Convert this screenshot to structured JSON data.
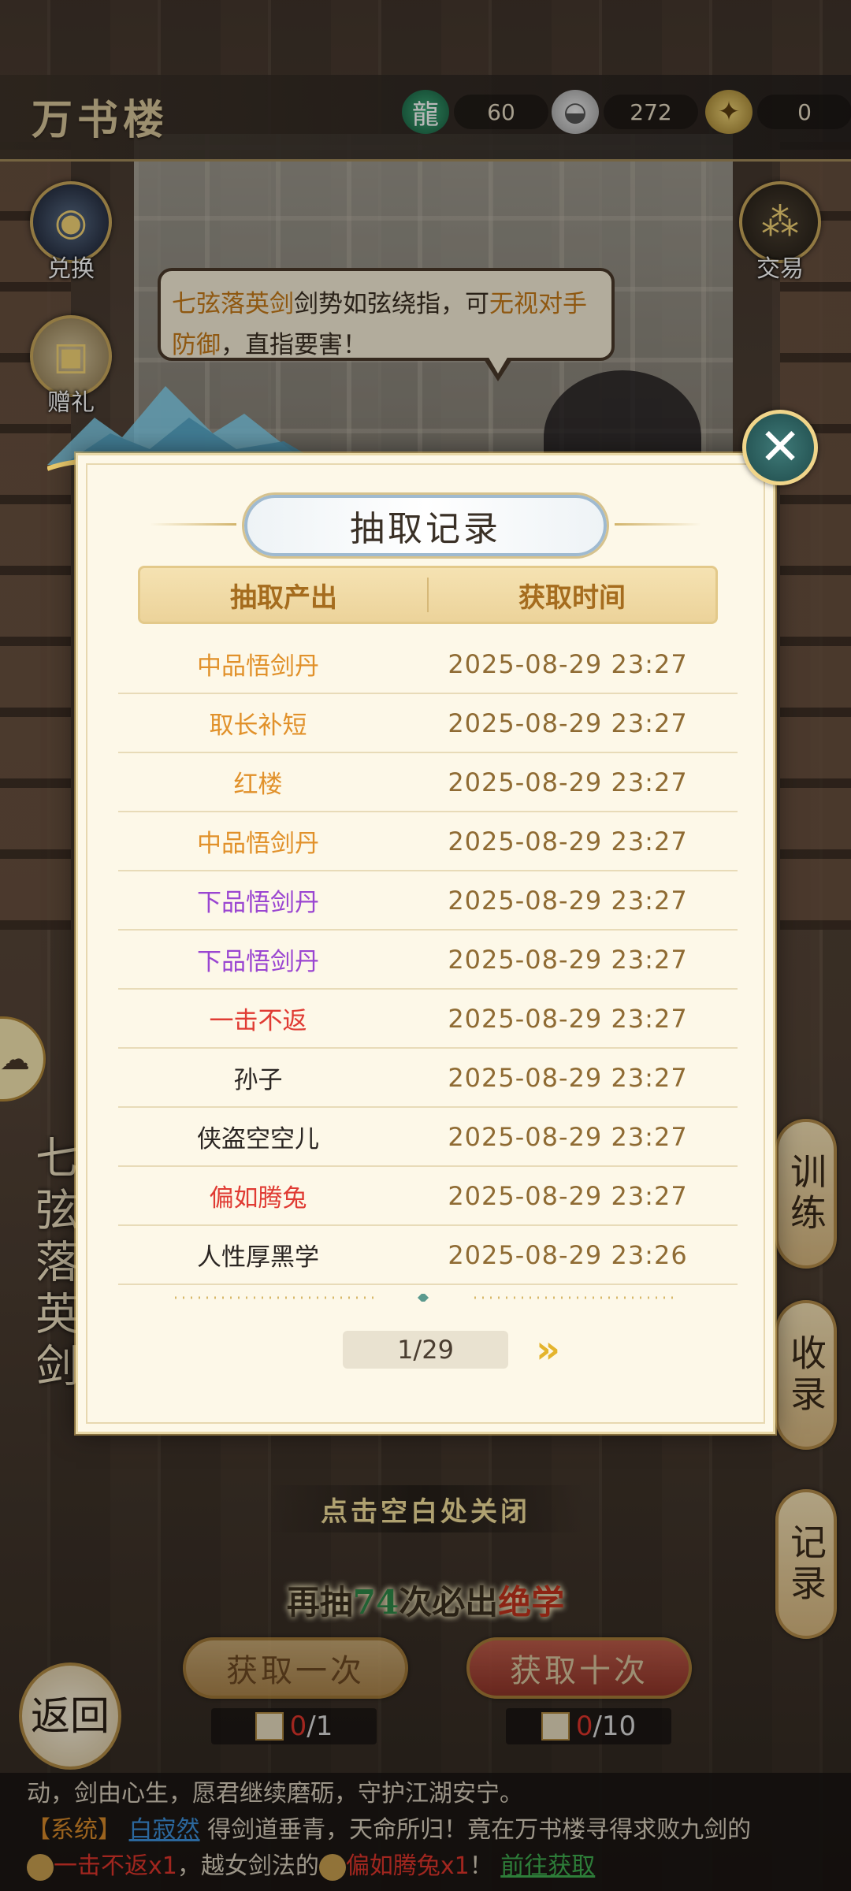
{
  "header": {
    "title": "万书楼",
    "currencies": [
      {
        "icon": "jade-dragon-icon",
        "value": "60"
      },
      {
        "icon": "silver-ingot-icon",
        "value": "272"
      },
      {
        "icon": "ticket-scroll-icon",
        "value": "0"
      }
    ]
  },
  "side_buttons": {
    "exchange": "兑换",
    "gift": "赠礼",
    "trade": "交易"
  },
  "bubble": {
    "part1": "七弦落英剑",
    "part2": "剑势如弦绕指，可",
    "part3": "无视对手防御",
    "part4": "，直指要害！"
  },
  "vertical_title": "七弦落英剑",
  "right_tabs": {
    "train": "训练",
    "collect": "收录",
    "record": "记录"
  },
  "modal": {
    "title": "抽取记录",
    "col_output": "抽取产出",
    "col_time": "获取时间",
    "rows": [
      {
        "name": "中品悟剑丹",
        "quality": "orange",
        "time": "2025-08-29   23:27"
      },
      {
        "name": "取长补短",
        "quality": "orange",
        "time": "2025-08-29   23:27"
      },
      {
        "name": "红楼",
        "quality": "orange",
        "time": "2025-08-29   23:27"
      },
      {
        "name": "中品悟剑丹",
        "quality": "orange",
        "time": "2025-08-29   23:27"
      },
      {
        "name": "下品悟剑丹",
        "quality": "purple",
        "time": "2025-08-29   23:27"
      },
      {
        "name": "下品悟剑丹",
        "quality": "purple",
        "time": "2025-08-29   23:27"
      },
      {
        "name": "一击不返",
        "quality": "red",
        "time": "2025-08-29   23:27"
      },
      {
        "name": "孙子",
        "quality": "black",
        "time": "2025-08-29   23:27"
      },
      {
        "name": "侠盗空空儿",
        "quality": "black",
        "time": "2025-08-29   23:27"
      },
      {
        "name": "偏如腾兔",
        "quality": "red",
        "time": "2025-08-29   23:27"
      },
      {
        "name": "人性厚黑学",
        "quality": "black",
        "time": "2025-08-29   23:26"
      }
    ],
    "page": "1/29",
    "quality_colors": {
      "orange": "#e1912a",
      "purple": "#9a45d1",
      "red": "#e03b33",
      "black": "#2a2522"
    }
  },
  "bottom": {
    "tap_close": "点击空白处关闭",
    "pity_prefix": "再抽",
    "pity_count": "74",
    "pity_mid": "次必出",
    "pity_item": "绝学",
    "draw_once": "获取一次",
    "draw_ten": "获取十次",
    "cost_once_have": "0",
    "cost_once_need": "/1",
    "cost_ten_have": "0",
    "cost_ten_need": "/10",
    "back": "返回"
  },
  "chat": {
    "line1": "动，剑由心生，愿君继续磨砺，守护江湖安宁。",
    "sys_tag": "【系统】",
    "user": "白寂然",
    "line2_text": "得剑道垂青，天命所归！竟在万书楼寻得求败九剑的",
    "item1": "一击不返x1",
    "mid": "，越女剑法的",
    "item2": "偏如腾兔x1",
    "end": "！",
    "link": "前往获取"
  }
}
